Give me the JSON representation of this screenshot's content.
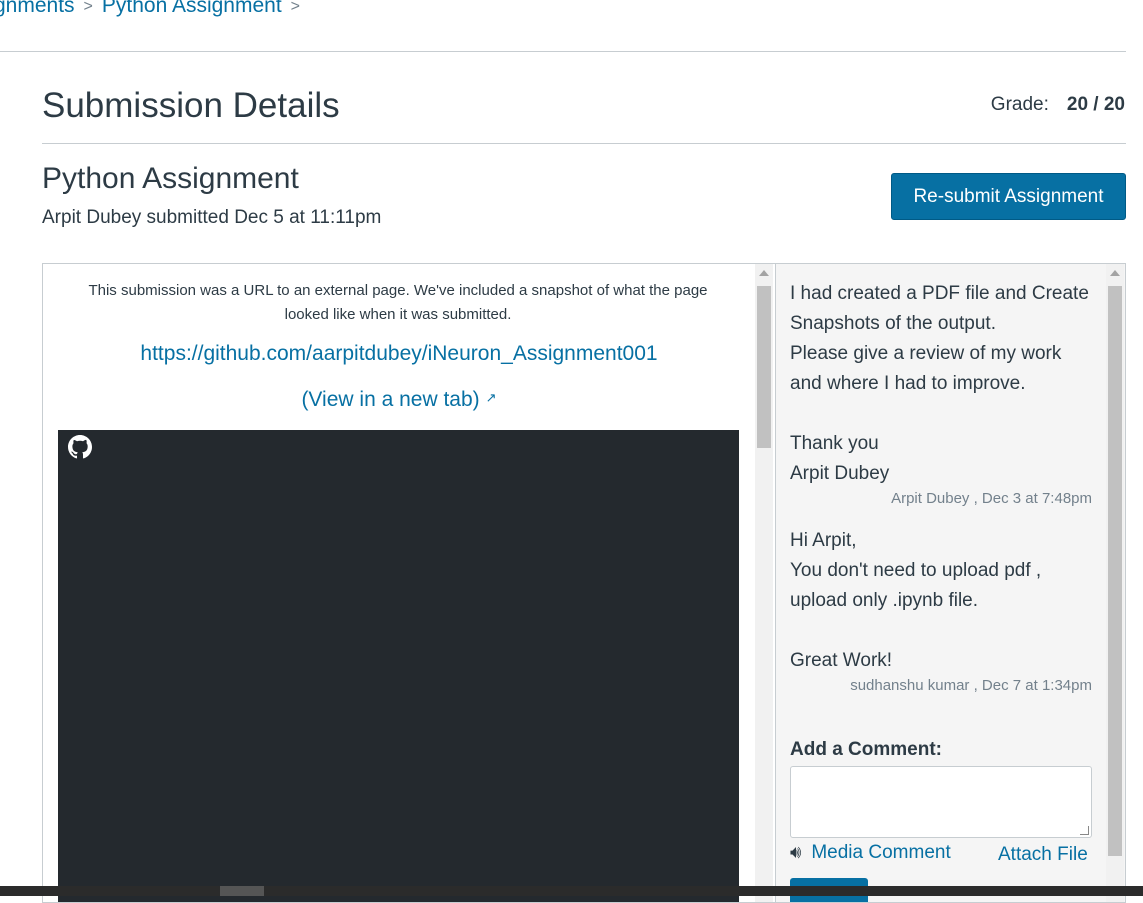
{
  "breadcrumb": {
    "items": [
      "gnments",
      "Python Assignment"
    ],
    "separator": ">"
  },
  "header": {
    "title": "Submission Details",
    "grade_label": "Grade:",
    "grade_value": "20 / 20"
  },
  "assignment": {
    "name": "Python Assignment",
    "submitted_text": "Arpit Dubey submitted Dec 5 at 11:11pm",
    "resubmit_label": "Re-submit Assignment"
  },
  "submission": {
    "notice": "This submission was a URL to an external page. We've included a snapshot of what the page looked like when it was submitted.",
    "url": "https://github.com/aarpitdubey/iNeuron_Assignment001",
    "view_new_tab": "(View in a new tab)",
    "snapshot_icon": "github-icon"
  },
  "comments": [
    {
      "body": "I had created a PDF file and Create Snapshots of the output.\nPlease give a review of my work and where I had to improve.\n\nThank you\nArpit Dubey",
      "meta": "Arpit Dubey , Dec 3 at 7:48pm"
    },
    {
      "body": "Hi Arpit,\nYou don't need to upload pdf , upload only .ipynb file.\n\nGreat Work!",
      "meta": "sudhanshu kumar , Dec 7 at 1:34pm"
    }
  ],
  "comment_form": {
    "label": "Add a Comment:",
    "value": "",
    "media_label": "Media Comment",
    "attach_label": "Attach File"
  },
  "colors": {
    "link": "#0770a3",
    "text": "#2d3b45",
    "snapshot_bg": "#24292e",
    "panel_bg": "#f5f5f5"
  }
}
